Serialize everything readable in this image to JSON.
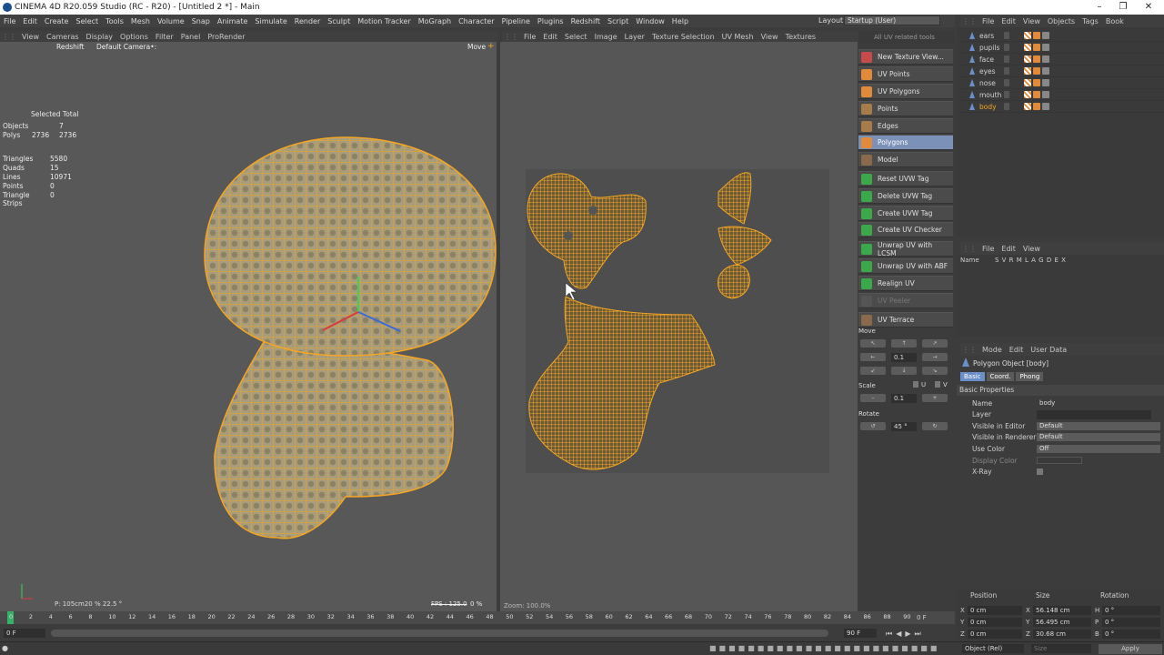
{
  "window": {
    "title": "CINEMA 4D R20.059 Studio (RC - R20) - [Untitled 2 *] - Main"
  },
  "menubar": [
    "File",
    "Edit",
    "Create",
    "Select",
    "Tools",
    "Mesh",
    "Volume",
    "Snap",
    "Animate",
    "Simulate",
    "Render",
    "Sculpt",
    "Motion Tracker",
    "MoGraph",
    "Character",
    "Pipeline",
    "Plugins",
    "Redshift",
    "Script",
    "Window",
    "Help"
  ],
  "layout": {
    "label": "Layout:",
    "value": "Startup (User)"
  },
  "viewport": {
    "menu": [
      "View",
      "Cameras",
      "Display",
      "Options",
      "Filter",
      "Panel",
      "ProRender"
    ],
    "renderer": "Redshift",
    "camera": "Default Camera",
    "camera_suffix": "•:",
    "move_label": "Move",
    "stats_header": "Selected Total",
    "stats": [
      {
        "label": "Objects",
        "sel": "",
        "total": "7"
      },
      {
        "label": "Polys",
        "sel": "2736",
        "total": "2736"
      }
    ],
    "stats2": [
      {
        "label": "Triangles",
        "value": "5580"
      },
      {
        "label": "Quads",
        "value": "15"
      },
      {
        "label": "Lines",
        "value": "10971"
      },
      {
        "label": "Points",
        "value": "0"
      },
      {
        "label": "Triangle Strips",
        "value": "0"
      }
    ],
    "hud_bottom": "P:  105cm20 % 22.5 °",
    "fps": "FPS : 125.0",
    "percent": "0 %"
  },
  "uvview": {
    "menu": [
      "File",
      "Edit",
      "Select",
      "Image",
      "Layer",
      "Texture Selection",
      "UV Mesh",
      "View",
      "Textures"
    ],
    "zoom": "Zoom: 100.0%"
  },
  "uvtools": {
    "header": "All UV related tools",
    "buttons": [
      {
        "label": "New Texture View...",
        "state": "normal"
      },
      {
        "label": "UV Points",
        "state": "normal"
      },
      {
        "label": "UV Polygons",
        "state": "normal"
      },
      {
        "label": "Points",
        "state": "normal"
      },
      {
        "label": "Edges",
        "state": "normal"
      },
      {
        "label": "Polygons",
        "state": "selected"
      },
      {
        "label": "Model",
        "state": "normal"
      },
      {
        "label": "Reset UVW Tag",
        "state": "normal"
      },
      {
        "label": "Delete UVW Tag",
        "state": "normal"
      },
      {
        "label": "Create UVW Tag",
        "state": "normal"
      },
      {
        "label": "Create UV Checker",
        "state": "normal"
      },
      {
        "label": "Unwrap UV with LCSM",
        "state": "normal"
      },
      {
        "label": "Unwrap UV with ABF",
        "state": "normal"
      },
      {
        "label": "Realign UV",
        "state": "normal"
      },
      {
        "label": "UV Peeler",
        "state": "disabled"
      },
      {
        "label": "UV Terrace",
        "state": "normal"
      }
    ],
    "move_label": "Move",
    "move_value": "0.1",
    "scale_label": "Scale",
    "scale_u": "U",
    "scale_v": "V",
    "scale_value": "0.1",
    "rotate_label": "Rotate",
    "rotate_value": "45 °"
  },
  "objects": {
    "menu": [
      "File",
      "Edit",
      "View",
      "Objects",
      "Tags",
      "Book"
    ],
    "items": [
      {
        "name": "ears",
        "active": false
      },
      {
        "name": "pupils",
        "active": false
      },
      {
        "name": "face",
        "active": false
      },
      {
        "name": "eyes",
        "active": false
      },
      {
        "name": "nose",
        "active": false
      },
      {
        "name": "mouth",
        "active": false
      },
      {
        "name": "body",
        "active": true
      }
    ]
  },
  "layers": {
    "menu": [
      "File",
      "Edit",
      "View"
    ],
    "name_col": "Name",
    "cols": "S V R M L A G D E X"
  },
  "attributes": {
    "menu": [
      "Mode",
      "Edit",
      "User Data"
    ],
    "object_title": "Polygon Object [body]",
    "tabs": [
      {
        "label": "Basic",
        "active": true
      },
      {
        "label": "Coord.",
        "active": false
      },
      {
        "label": "Phong",
        "active": false
      }
    ],
    "section": "Basic Properties",
    "rows": [
      {
        "label": "Name",
        "value": "body",
        "kind": "text"
      },
      {
        "label": "Layer",
        "value": "",
        "kind": "text"
      },
      {
        "label": "Visible in Editor",
        "value": "Default",
        "kind": "dropdown"
      },
      {
        "label": "Visible in Renderer",
        "value": "Default",
        "kind": "dropdown"
      },
      {
        "label": "Use Color",
        "value": "Off",
        "kind": "dropdown"
      },
      {
        "label": "Display Color",
        "value": "",
        "kind": "color"
      },
      {
        "label": "X-Ray",
        "value": "",
        "kind": "check"
      }
    ]
  },
  "coords": {
    "headers": [
      "Position",
      "Size",
      "Rotation"
    ],
    "rows": [
      {
        "axis": "X",
        "pos": "0 cm",
        "size_axis": "X",
        "size": "56.148 cm",
        "rot_axis": "H",
        "rot": "0 °"
      },
      {
        "axis": "Y",
        "pos": "0 cm",
        "size_axis": "Y",
        "size": "56.495 cm",
        "rot_axis": "P",
        "rot": "0 °"
      },
      {
        "axis": "Z",
        "pos": "0 cm",
        "size_axis": "Z",
        "size": "30.68 cm",
        "rot_axis": "B",
        "rot": "0 °"
      }
    ],
    "mode": "Object (Rel)",
    "size_mode": "Size",
    "apply": "Apply"
  },
  "timeline": {
    "ticks": [
      "0",
      "2",
      "4",
      "6",
      "8",
      "10",
      "12",
      "14",
      "16",
      "18",
      "20",
      "22",
      "24",
      "26",
      "28",
      "30",
      "32",
      "34",
      "36",
      "38",
      "40",
      "42",
      "44",
      "46",
      "48",
      "50",
      "52",
      "54",
      "56",
      "58",
      "60",
      "62",
      "64",
      "66",
      "68",
      "70",
      "72",
      "74",
      "76",
      "78",
      "80",
      "82",
      "84",
      "86",
      "88",
      "90"
    ],
    "frame": "0 F",
    "start": "0 F",
    "end": "90 F",
    "end2": "90 F"
  },
  "colors": {
    "wire": "#f5a623",
    "accent": "#7c91b8",
    "panel": "#3c3c3c"
  }
}
